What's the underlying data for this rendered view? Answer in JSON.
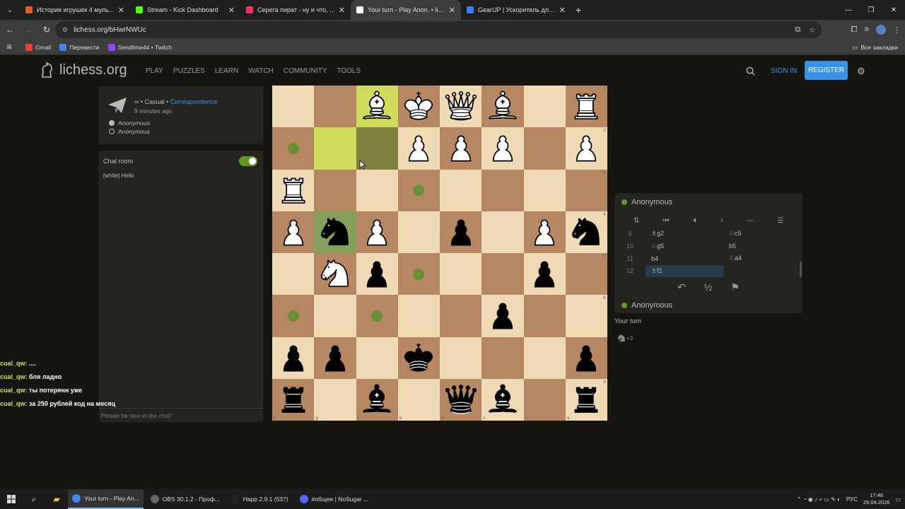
{
  "browser": {
    "tabs": [
      {
        "title": "История игрушек 4 мультфил...",
        "color": "#e05a2b",
        "active": false
      },
      {
        "title": "Stream - Kick Dashboard",
        "color": "#53fc18",
        "active": false
      },
      {
        "title": "Серега пират - ну и что, ...",
        "color": "#ff2e5b",
        "active": false
      },
      {
        "title": "Your turn - Play Anon. • liches...",
        "color": "#ffffff",
        "active": true
      },
      {
        "title": "GearUP | Ускоритель для всех...",
        "color": "#3b7bf6",
        "active": false
      }
    ],
    "url": "lichess.org/bHwrNWUc",
    "bookmarks": [
      {
        "label": "Gmail",
        "color": "#ea4335"
      },
      {
        "label": "Перевести",
        "color": "#4285f4"
      },
      {
        "label": "Sendlime44 • Twitch",
        "color": "#9146ff"
      }
    ],
    "all_bookmarks": "Все закладки"
  },
  "site": {
    "logo": "lichess.org",
    "nav": [
      "PLAY",
      "PUZZLES",
      "LEARN",
      "WATCH",
      "COMMUNITY",
      "TOOLS"
    ],
    "sign_in": "SIGN IN",
    "register": "REGISTER"
  },
  "game_info": {
    "type_prefix": "∞ • Casual • ",
    "type_link": "Correspondence",
    "time_ago": "9 minutes ago",
    "white_player": "Anonymous",
    "black_player": "Anonymous"
  },
  "chat": {
    "title": "Chat room",
    "enabled": true,
    "messages": [
      "[white] Hello"
    ],
    "placeholder": "Please be nice in the chat!"
  },
  "stream_overlay": [
    {
      "user": "cual_qw:",
      "text": "...."
    },
    {
      "user": "cual_qw:",
      "text": "бля ладно"
    },
    {
      "user": "cual_qw:",
      "text": "ты потерянн уже"
    },
    {
      "user": "cual_qw:",
      "text": "за 250 рублей код на месяц"
    }
  ],
  "board": {
    "orientation": "black",
    "rank_labels": [
      "1",
      "2",
      "3",
      "4",
      "5",
      "6",
      "7",
      "8"
    ],
    "file_labels": [
      "h",
      "g",
      "f",
      "e",
      "d",
      "c",
      "b",
      "a"
    ],
    "pieces": [
      {
        "r": 0,
        "c": 2,
        "p": "wB"
      },
      {
        "r": 0,
        "c": 3,
        "p": "wK"
      },
      {
        "r": 0,
        "c": 4,
        "p": "wQ"
      },
      {
        "r": 0,
        "c": 5,
        "p": "wB"
      },
      {
        "r": 0,
        "c": 7,
        "p": "wR"
      },
      {
        "r": 1,
        "c": 3,
        "p": "wP"
      },
      {
        "r": 1,
        "c": 4,
        "p": "wP"
      },
      {
        "r": 1,
        "c": 5,
        "p": "wP"
      },
      {
        "r": 1,
        "c": 7,
        "p": "wP"
      },
      {
        "r": 2,
        "c": 0,
        "p": "wR"
      },
      {
        "r": 3,
        "c": 0,
        "p": "wP"
      },
      {
        "r": 3,
        "c": 1,
        "p": "bN"
      },
      {
        "r": 3,
        "c": 2,
        "p": "wP"
      },
      {
        "r": 3,
        "c": 4,
        "p": "bP"
      },
      {
        "r": 3,
        "c": 6,
        "p": "wP"
      },
      {
        "r": 3,
        "c": 7,
        "p": "bN"
      },
      {
        "r": 4,
        "c": 1,
        "p": "wN"
      },
      {
        "r": 4,
        "c": 2,
        "p": "bP"
      },
      {
        "r": 4,
        "c": 6,
        "p": "bP"
      },
      {
        "r": 5,
        "c": 5,
        "p": "bP"
      },
      {
        "r": 6,
        "c": 0,
        "p": "bP"
      },
      {
        "r": 6,
        "c": 1,
        "p": "bP"
      },
      {
        "r": 6,
        "c": 3,
        "p": "bK"
      },
      {
        "r": 6,
        "c": 7,
        "p": "bP"
      },
      {
        "r": 7,
        "c": 0,
        "p": "bR"
      },
      {
        "r": 7,
        "c": 2,
        "p": "bB"
      },
      {
        "r": 7,
        "c": 4,
        "p": "bQ"
      },
      {
        "r": 7,
        "c": 5,
        "p": "bB"
      },
      {
        "r": 7,
        "c": 7,
        "p": "bR"
      }
    ],
    "highlights": [
      {
        "r": 0,
        "c": 2,
        "kind": "hl-light"
      },
      {
        "r": 1,
        "c": 1,
        "kind": "hl-light"
      },
      {
        "r": 1,
        "c": 2,
        "kind": "hl-sel"
      },
      {
        "r": 3,
        "c": 1,
        "kind": "hl-green"
      }
    ],
    "move_dots": [
      {
        "r": 1,
        "c": 0
      },
      {
        "r": 2,
        "c": 3
      },
      {
        "r": 4,
        "c": 3
      },
      {
        "r": 5,
        "c": 0
      },
      {
        "r": 5,
        "c": 2
      }
    ]
  },
  "right_panel": {
    "top_player": "Anonymous",
    "bottom_player": "Anonymous",
    "moves": [
      {
        "n": "9",
        "w": "♗g2",
        "b": "♘c5"
      },
      {
        "n": "10",
        "w": "♘g5",
        "b": "b5"
      },
      {
        "n": "11",
        "w": "b4",
        "b": "♘a4"
      },
      {
        "n": "12",
        "w": "♗f1",
        "b": ""
      }
    ],
    "half": "½",
    "your_turn": "Your turn",
    "material": "+3"
  },
  "taskbar": {
    "apps": [
      {
        "label": "Your turn - Play An...",
        "color": "#4285f4",
        "active": true
      },
      {
        "label": "OBS 30.1.2 - Проф...",
        "color": "#666666",
        "active": false
      },
      {
        "label": "Happ 2.9.1 (537)",
        "color": "#222222",
        "active": false
      },
      {
        "label": "#общее | NoSugar ...",
        "color": "#5865f2",
        "active": false
      }
    ],
    "lang": "РУС",
    "time": "17:48",
    "date": "29.04.2026"
  }
}
